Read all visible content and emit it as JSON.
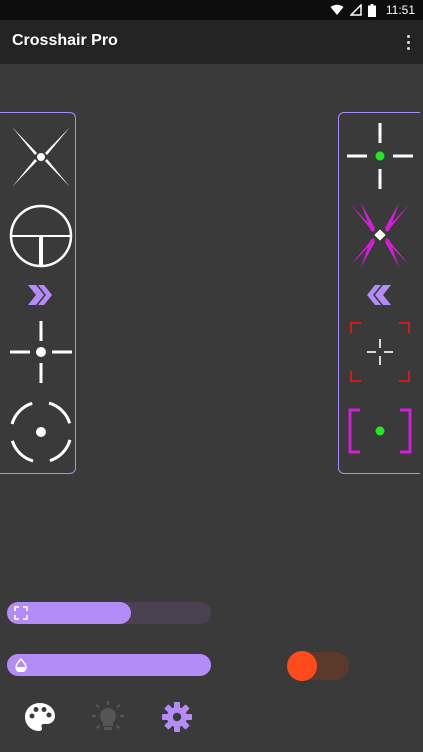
{
  "status_bar": {
    "time": "11:51",
    "icons": [
      "wifi-icon",
      "signal-icon",
      "battery-icon"
    ]
  },
  "app_bar": {
    "title": "Crosshair Pro",
    "menu_icon": "overflow-menu-icon"
  },
  "left_panel": {
    "items": [
      "x-crosshair",
      "scope-crosshair",
      "next-arrow",
      "cross-dot-crosshair",
      "circle-dot-crosshair"
    ]
  },
  "right_panel": {
    "items": [
      "green-dot-cross-crosshair",
      "magenta-x-crosshair",
      "prev-arrow",
      "red-corner-crosshair",
      "magenta-bracket-crosshair"
    ]
  },
  "sliders": {
    "size": {
      "icon": "expand-icon",
      "value": 0.6
    },
    "opacity": {
      "icon": "opacity-drop-icon",
      "value": 1.0
    }
  },
  "toggle": {
    "state": "on",
    "color": "#ff4a1c"
  },
  "bottom_nav": {
    "items": [
      "palette-icon",
      "brightness-icon",
      "settings-icon"
    ]
  },
  "colors": {
    "accent": "#b48cf7",
    "panel_border": "#a78bfa",
    "background": "#3b3a3b",
    "app_bar": "#242424"
  }
}
